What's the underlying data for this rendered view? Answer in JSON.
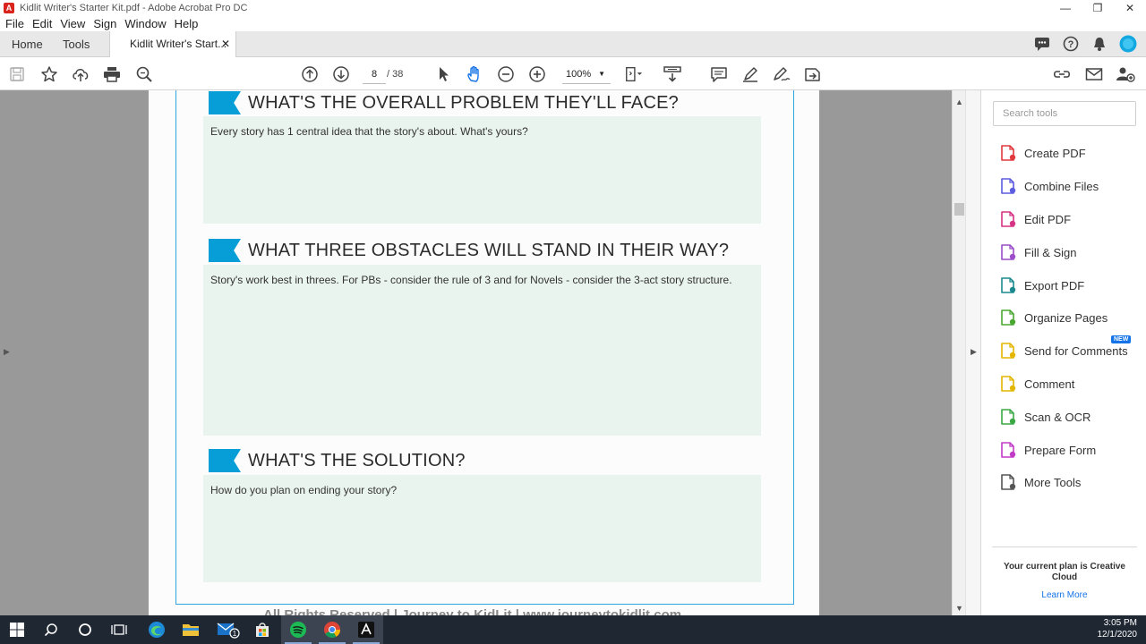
{
  "window": {
    "title": "Kidlit Writer's Starter Kit.pdf - Adobe Acrobat Pro DC",
    "controls": [
      "—",
      "❐",
      "✕"
    ]
  },
  "menu": [
    "File",
    "Edit",
    "View",
    "Sign",
    "Window",
    "Help"
  ],
  "tabs": {
    "home": "Home",
    "tools": "Tools",
    "document": "Kidlit Writer's Start...",
    "close": "✕"
  },
  "toolbar": {
    "page_current": "8",
    "page_total": "/  38",
    "zoom": "100%"
  },
  "document": {
    "sections": [
      {
        "title": "WHAT'S THE OVERALL PROBLEM THEY'LL FACE?",
        "prompt": "Every story has 1 central idea that the story's about. What's yours?"
      },
      {
        "title": "WHAT THREE OBSTACLES WILL STAND IN THEIR WAY?",
        "prompt": "Story's work best in threes. For PBs - consider the rule of 3 and for Novels - consider the 3-act story structure."
      },
      {
        "title": "WHAT'S THE SOLUTION?",
        "prompt": "How do you plan on ending your story?"
      }
    ],
    "footer": "All Rights Reserved | Journey to KidLit | www.journeytokidlit.com"
  },
  "tools_panel": {
    "search_placeholder": "Search tools",
    "items": [
      {
        "label": "Create PDF",
        "icon": "create-pdf-icon",
        "color": "#e0393e"
      },
      {
        "label": "Combine Files",
        "icon": "combine-files-icon",
        "color": "#5c5ce0"
      },
      {
        "label": "Edit PDF",
        "icon": "edit-pdf-icon",
        "color": "#d63384"
      },
      {
        "label": "Fill & Sign",
        "icon": "fill-sign-icon",
        "color": "#9b4dca"
      },
      {
        "label": "Export PDF",
        "icon": "export-pdf-icon",
        "color": "#1b8a8f"
      },
      {
        "label": "Organize Pages",
        "icon": "organize-pages-icon",
        "color": "#4aa832"
      },
      {
        "label": "Send for Comments",
        "icon": "send-comments-icon",
        "color": "#e3b600"
      },
      {
        "label": "Comment",
        "icon": "comment-icon",
        "color": "#e3b600"
      },
      {
        "label": "Scan & OCR",
        "icon": "scan-ocr-icon",
        "color": "#3aa845"
      },
      {
        "label": "Prepare Form",
        "icon": "prepare-form-icon",
        "color": "#c23bc7"
      },
      {
        "label": "More Tools",
        "icon": "more-tools-icon",
        "color": "#555555"
      }
    ],
    "new_badge": "NEW",
    "plan_text": "Your current plan is Creative Cloud",
    "learn_more": "Learn More"
  },
  "taskbar": {
    "time": "3:05 PM",
    "date": "12/1/2020",
    "mail_badge": "1"
  },
  "colors": {
    "accent": "#079ed8",
    "answer_bg": "#eaf4ef",
    "frame": "#2fa6dc"
  }
}
